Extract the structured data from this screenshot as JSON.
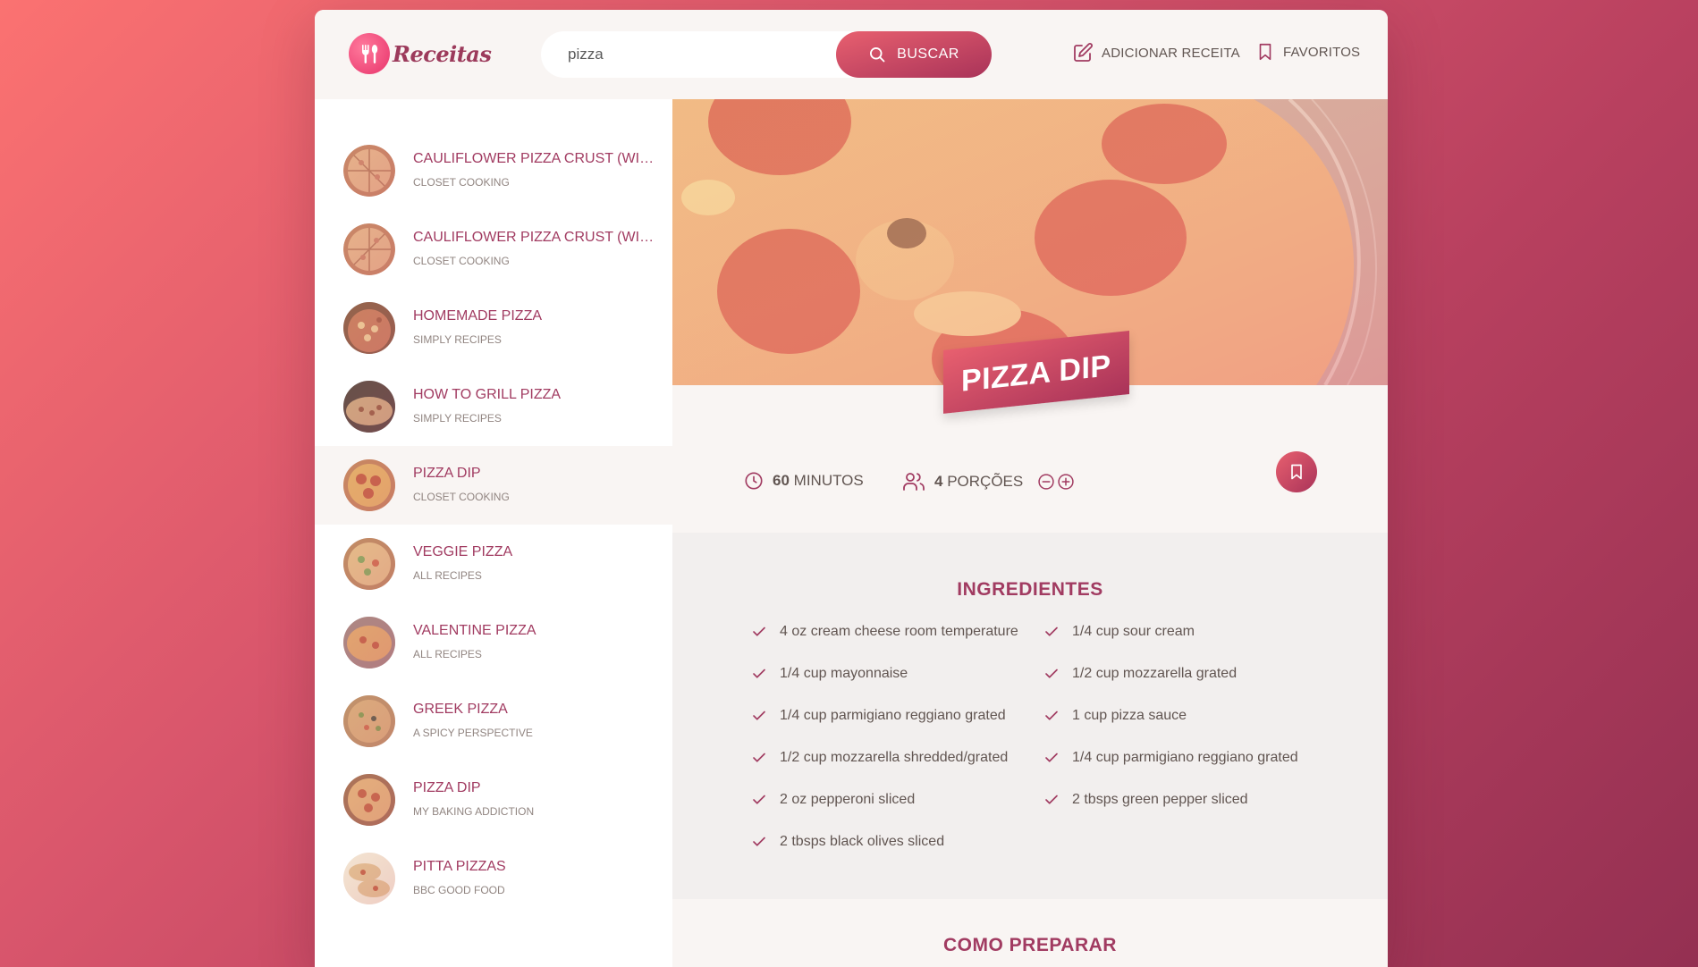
{
  "app": {
    "logo_text": "Receitas"
  },
  "search": {
    "value": "pizza",
    "button_label": "Buscar"
  },
  "nav": {
    "add_recipe": "Adicionar receita",
    "favorites": "Favoritos"
  },
  "results": [
    {
      "title": "Cauliflower Pizza Crust (with BBQ Chicken Pizza)",
      "publisher": "Closet Cooking",
      "active": false
    },
    {
      "title": "Cauliflower Pizza Crust (with BBQ Chicken Pizza)",
      "publisher": "Closet Cooking",
      "active": false
    },
    {
      "title": "Homemade Pizza",
      "publisher": "Simply Recipes",
      "active": false
    },
    {
      "title": "How to Grill Pizza",
      "publisher": "Simply Recipes",
      "active": false
    },
    {
      "title": "Pizza Dip",
      "publisher": "Closet Cooking",
      "active": true
    },
    {
      "title": "Veggie Pizza",
      "publisher": "All Recipes",
      "active": false
    },
    {
      "title": "Valentine Pizza",
      "publisher": "All Recipes",
      "active": false
    },
    {
      "title": "Greek Pizza",
      "publisher": "A Spicy Perspective",
      "active": false
    },
    {
      "title": "Pizza Dip",
      "publisher": "My Baking Addiction",
      "active": false
    },
    {
      "title": "Pitta Pizzas",
      "publisher": "BBC Good Food",
      "active": false
    }
  ],
  "recipe": {
    "title": "Pizza Dip",
    "time_value": "60",
    "time_unit": "minutos",
    "servings_value": "4",
    "servings_unit": "porções",
    "ingredients_heading": "Ingredientes",
    "ingredients_left": [
      "4 oz cream cheese room temperature",
      "1/4 cup mayonnaise",
      "1/4 cup parmigiano reggiano grated",
      "1/2 cup mozzarella shredded/grated",
      "2 oz pepperoni sliced",
      "2 tbsps black olives sliced"
    ],
    "ingredients_right": [
      "1/4 cup sour cream",
      "1/2 cup mozzarella grated",
      "1 cup pizza sauce",
      "1/4 cup parmigiano reggiano grated",
      "2 tbsps green pepper sliced"
    ],
    "directions_heading": "Como preparar"
  },
  "colors": {
    "accent": "#a13b61",
    "text": "#615551",
    "gradient_start": "#e8606f",
    "gradient_end": "#a93359"
  }
}
